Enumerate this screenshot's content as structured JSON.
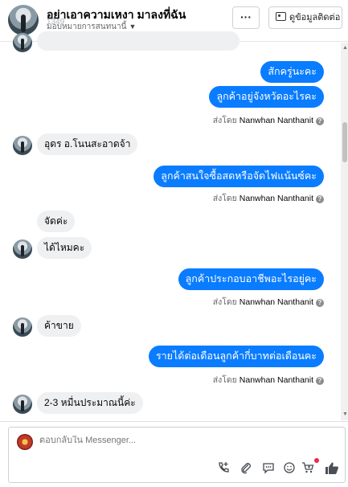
{
  "header": {
    "title": "อย่าเอาความเหงา มาลงที่ฉัน",
    "subtitle": "มอบหมายการสนทนานี้",
    "subtitle_ghost": "1349",
    "more_label": "···",
    "contact_label": "ดูข้อมูลติดต่อ"
  },
  "messages": [
    {
      "id": "m1",
      "dir": "out",
      "text": "สักครู่นะคะ"
    },
    {
      "id": "m2",
      "dir": "out",
      "text": "ลูกค้าอยู่จังหวัดอะไรคะ"
    },
    {
      "id": "m3",
      "dir": "in",
      "text": "อุดร อ.โนนสะอาดจ้า"
    },
    {
      "id": "m4",
      "dir": "out",
      "text": "ลูกค้าสนใจซื้อสดหรือจัดไฟแน้นซ์คะ"
    },
    {
      "id": "m5",
      "dir": "in",
      "text": "จัดค่ะ"
    },
    {
      "id": "m6",
      "dir": "in",
      "text": "ได้ไหมคะ"
    },
    {
      "id": "m7",
      "dir": "out",
      "text": "ลูกค้าประกอบอาชีพอะไรอยู่คะ"
    },
    {
      "id": "m8",
      "dir": "in",
      "text": "ค้าขาย"
    },
    {
      "id": "m9",
      "dir": "out",
      "text": "รายได้ต่อเดือนลูกค้ากี่บาทต่อเดือนคะ"
    },
    {
      "id": "m10",
      "dir": "in",
      "text": "2-3 หมื่นประมาณนี้ค่ะ"
    }
  ],
  "sent_by": {
    "prefix": "ส่งโดย",
    "name": "Nanwhan Nanthanit",
    "help": "?"
  },
  "composer": {
    "placeholder": "ตอบกลับใน Messenger...",
    "icons": [
      "phone-plus-icon",
      "attachment-icon",
      "speech-bubble-icon",
      "emoji-icon",
      "cart-icon",
      "like-icon"
    ]
  },
  "colors": {
    "outgoing_bubble": "#0a7cff",
    "incoming_bubble": "#eff0f2",
    "accent_dot": "#f02849"
  }
}
